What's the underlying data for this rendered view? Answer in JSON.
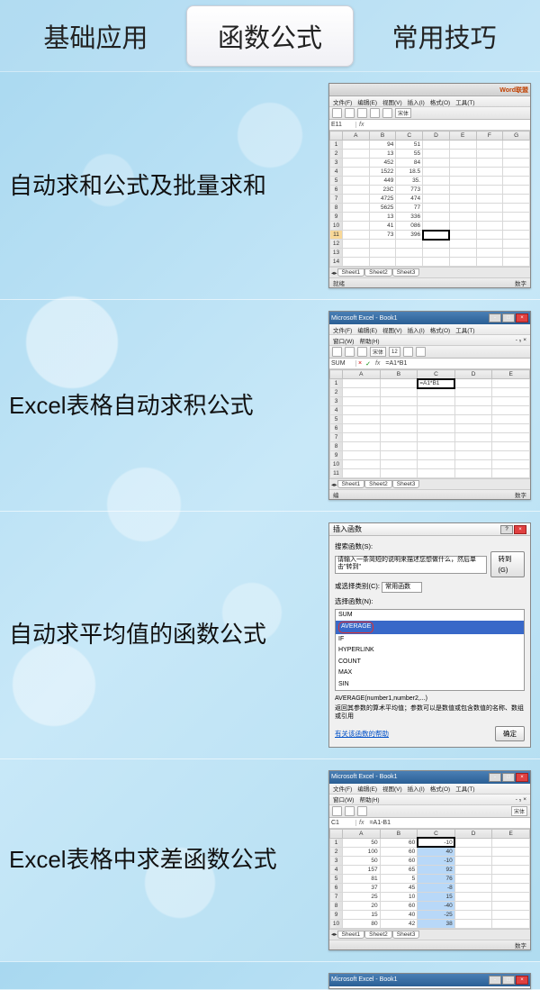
{
  "tabs": [
    {
      "label": "基础应用",
      "active": false
    },
    {
      "label": "函数公式",
      "active": true
    },
    {
      "label": "常用技巧",
      "active": false
    }
  ],
  "items": [
    {
      "title": "自动求和公式及批量求和"
    },
    {
      "title": "Excel表格自动求积公式"
    },
    {
      "title": "自动求平均值的函数公式"
    },
    {
      "title": "Excel表格中求差函数公式"
    }
  ],
  "thumb1": {
    "menu": [
      "文件(F)",
      "编辑(E)",
      "视图(V)",
      "插入(I)",
      "格式(O)",
      "工具(T)"
    ],
    "font": "宋体",
    "namebox": "E11",
    "cols": [
      "",
      "A",
      "B",
      "C",
      "D",
      "E",
      "F",
      "G"
    ],
    "rows": [
      [
        "1",
        "",
        "94",
        "51",
        "",
        "",
        "",
        ""
      ],
      [
        "2",
        "",
        "13",
        "55",
        "",
        "",
        "",
        ""
      ],
      [
        "3",
        "",
        "452",
        "84",
        "",
        "",
        "",
        ""
      ],
      [
        "4",
        "",
        "1522",
        "18.5",
        "",
        "",
        "",
        ""
      ],
      [
        "5",
        "",
        "449",
        "35.",
        "",
        "",
        "",
        ""
      ],
      [
        "6",
        "",
        "23C",
        "773",
        "",
        "",
        "",
        ""
      ],
      [
        "7",
        "",
        "4725",
        "474",
        "",
        "",
        "",
        ""
      ],
      [
        "8",
        "",
        "5625",
        "77",
        "",
        "",
        "",
        ""
      ],
      [
        "9",
        "",
        "13",
        "336",
        "",
        "",
        "",
        ""
      ],
      [
        "10",
        "",
        "41",
        "086",
        "",
        "",
        "",
        ""
      ],
      [
        "11",
        "",
        "73",
        "396",
        "",
        "",
        "",
        ""
      ],
      [
        "12",
        "",
        "",
        "",
        "",
        "",
        "",
        ""
      ],
      [
        "13",
        "",
        "",
        "",
        "",
        "",
        "",
        ""
      ],
      [
        "14",
        "",
        "",
        "",
        "",
        "",
        "",
        ""
      ]
    ],
    "sheets": [
      "Sheet1",
      "Sheet2",
      "Sheet3"
    ],
    "status_left": "就绪",
    "status_right": "数字"
  },
  "thumb2": {
    "title": "Microsoft Excel - Book1",
    "menu": [
      "文件(F)",
      "编辑(E)",
      "视图(V)",
      "插入(I)",
      "格式(O)",
      "工具(T)"
    ],
    "menu2": [
      "窗口(W)",
      "帮助(H)"
    ],
    "font": "宋体",
    "fontsize": "12",
    "namebox": "SUM",
    "formula": "=A1*B1",
    "cols": [
      "",
      "A",
      "B",
      "C",
      "D",
      "E"
    ],
    "rows": [
      [
        "1",
        "",
        "",
        "=A1*B1",
        "",
        ""
      ],
      [
        "2",
        "",
        "",
        "",
        "",
        ""
      ],
      [
        "3",
        "",
        "",
        "",
        "",
        ""
      ],
      [
        "4",
        "",
        "",
        "",
        "",
        ""
      ],
      [
        "5",
        "",
        "",
        "",
        "",
        ""
      ],
      [
        "6",
        "",
        "",
        "",
        "",
        ""
      ],
      [
        "7",
        "",
        "",
        "",
        "",
        ""
      ],
      [
        "8",
        "",
        "",
        "",
        "",
        ""
      ],
      [
        "9",
        "",
        "",
        "",
        "",
        ""
      ],
      [
        "10",
        "",
        "",
        "",
        "",
        ""
      ],
      [
        "11",
        "",
        "",
        "",
        "",
        ""
      ]
    ],
    "sheets": [
      "Sheet1",
      "Sheet2",
      "Sheet3"
    ],
    "status_left": "编",
    "status_right": "数字"
  },
  "thumb3": {
    "title": "插入函数",
    "search_label": "搜索函数(S):",
    "search_hint": "请输入一条简短的说明来描述您想做什么，然后单击\"转到\"",
    "go_btn": "转到(G)",
    "category_label": "或选择类别(C):",
    "category_value": "常用函数",
    "list_label": "选择函数(N):",
    "functions": [
      "SUM",
      "AVERAGE",
      "IF",
      "HYPERLINK",
      "COUNT",
      "MAX",
      "SIN"
    ],
    "selected_index": 1,
    "desc_sig": "AVERAGE(number1,number2,...)",
    "desc_text": "返回其参数的算术平均值；参数可以是数值或包含数值的名称、数组或引用",
    "help_link": "有关该函数的帮助",
    "ok_btn": "确定"
  },
  "thumb4": {
    "title": "Microsoft Excel - Book1",
    "menu": [
      "文件(F)",
      "编辑(E)",
      "视图(V)",
      "插入(I)",
      "格式(O)",
      "工具(T)"
    ],
    "menu2": [
      "窗口(W)",
      "帮助(H)"
    ],
    "font": "宋体",
    "namebox": "C1",
    "formula": "=A1-B1",
    "cols": [
      "",
      "A",
      "B",
      "C",
      "D",
      "E"
    ],
    "rows": [
      [
        "1",
        "50",
        "60",
        "-10",
        "",
        ""
      ],
      [
        "2",
        "100",
        "60",
        "40",
        "",
        ""
      ],
      [
        "3",
        "50",
        "60",
        "-10",
        "",
        ""
      ],
      [
        "4",
        "157",
        "65",
        "92",
        "",
        ""
      ],
      [
        "5",
        "81",
        "5",
        "76",
        "",
        ""
      ],
      [
        "6",
        "37",
        "45",
        "-8",
        "",
        ""
      ],
      [
        "7",
        "25",
        "10",
        "15",
        "",
        ""
      ],
      [
        "8",
        "20",
        "60",
        "-40",
        "",
        ""
      ],
      [
        "9",
        "15",
        "40",
        "-25",
        "",
        ""
      ],
      [
        "10",
        "80",
        "42",
        "38",
        "",
        ""
      ]
    ],
    "sheets": [
      "Sheet1",
      "Sheet2",
      "Sheet3"
    ],
    "status_right": "数字"
  },
  "thumb5": {
    "title": "Microsoft Excel - Book1"
  }
}
